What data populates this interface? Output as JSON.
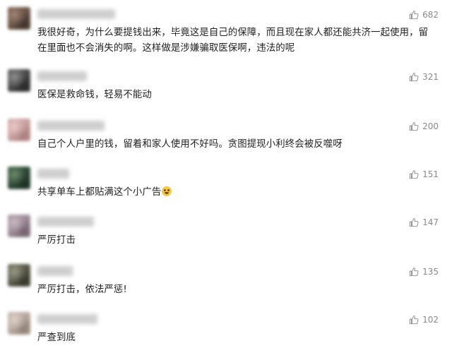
{
  "comments": [
    {
      "text": "我很好奇，为什么要提钱出来，毕竟这是自己的保障，而且现在家人都还能共济一起使用，留在里面也不会消失的啊。这样做是涉嫌骗取医保啊，违法的呢",
      "likes": "682",
      "avatar_colors": [
        "#6b5648",
        "#a08373",
        "#3e3129"
      ],
      "name_width": 110
    },
    {
      "text": "医保是救命钱，轻易不能动",
      "likes": "321",
      "avatar_colors": [
        "#4a4a4a",
        "#8e8e8e",
        "#262626"
      ],
      "name_width": 70
    },
    {
      "text": "自己个人户里的钱，留着和家人使用不好吗。贪图提现小利终会被反噬呀",
      "likes": "200",
      "avatar_colors": [
        "#c9a0a0",
        "#e9c8c6",
        "#a77e7c"
      ],
      "name_width": 95
    },
    {
      "text": "共享单车上都贴满这个小广告",
      "likes": "151",
      "emoji": "sweat-smile-emoji",
      "avatar_colors": [
        "#2f4a3a",
        "#6b8a6a",
        "#1e2e24"
      ],
      "name_width": 45
    },
    {
      "text": "严厉打击",
      "likes": "147",
      "avatar_colors": [
        "#9e8c98",
        "#c8b8c2",
        "#6f5f6a"
      ],
      "name_width": 80
    },
    {
      "text": "严厉打击，依法严惩!",
      "likes": "135",
      "avatar_colors": [
        "#5a5a4a",
        "#9a9a86",
        "#34342a"
      ],
      "name_width": 50
    },
    {
      "text": "严查到底",
      "likes": "102",
      "avatar_colors": [
        "#b8a9a0",
        "#dcd0c8",
        "#8e7e74"
      ],
      "name_width": 85
    }
  ],
  "colors": {
    "text": "#1f1f1f",
    "meta": "#8a8a8a",
    "background": "#ffffff"
  },
  "icons": {
    "like": "thumbs-up-icon"
  }
}
